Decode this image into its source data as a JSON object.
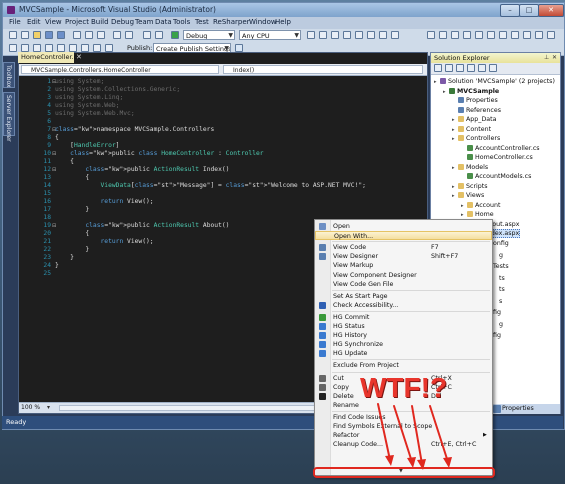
{
  "window": {
    "title": "MVCSample - Microsoft Visual Studio (Administrator)",
    "controls": {
      "minimize": "–",
      "maximize": "□",
      "close": "✕"
    }
  },
  "menu": [
    "File",
    "Edit",
    "View",
    "Project",
    "Build",
    "Debug",
    "Team",
    "Data",
    "Tools",
    "Test",
    "ReSharper",
    "Window",
    "Help"
  ],
  "toolbar": {
    "config": "Debug",
    "platform": "Any CPU",
    "publish_label": "Publish:",
    "publish_value": "Create Publish Settings"
  },
  "editor": {
    "tab": "HomeController.cs",
    "nav_left": "MVCSample.Controllers.HomeController",
    "nav_right": "Index()",
    "zoom": "100 %",
    "line_numbers": [
      "1",
      "2",
      "3",
      "4",
      "5",
      "6",
      "7",
      "8",
      "9",
      "10",
      "11",
      "12",
      "13",
      "14",
      "15",
      "16",
      "17",
      "18",
      "19",
      "20",
      "21",
      "22",
      "23",
      "24",
      "25"
    ],
    "code": [
      "using System;",
      "using System.Collections.Generic;",
      "using System.Linq;",
      "using System.Web;",
      "using System.Web.Mvc;",
      "",
      "namespace MVCSample.Controllers",
      "{",
      "    [HandleError]",
      "    public class HomeController : Controller",
      "    {",
      "        public ActionResult Index()",
      "        {",
      "            ViewData[\"Message\"] = \"Welcome to ASP.NET MVC!\";",
      "",
      "            return View();",
      "        }",
      "",
      "        public ActionResult About()",
      "        {",
      "            return View();",
      "        }",
      "    }",
      "}",
      ""
    ]
  },
  "side_tabs": [
    "Toolbox",
    "Server Explorer"
  ],
  "solution_explorer": {
    "title": "Solution Explorer",
    "nodes": [
      {
        "label": "Solution 'MVCSample' (2 projects)",
        "depth": 0,
        "icon": "solution-icon",
        "color": "#7d5aa8"
      },
      {
        "label": "MVCSample",
        "depth": 1,
        "icon": "project-icon",
        "color": "#3b7a3b"
      },
      {
        "label": "Properties",
        "depth": 2,
        "icon": "properties-icon",
        "color": "#5a7fb0"
      },
      {
        "label": "References",
        "depth": 2,
        "icon": "references-icon",
        "color": "#5a7fb0"
      },
      {
        "label": "App_Data",
        "depth": 2,
        "icon": "folder-icon",
        "color": "#e3c065"
      },
      {
        "label": "Content",
        "depth": 2,
        "icon": "folder-icon",
        "color": "#e3c065"
      },
      {
        "label": "Controllers",
        "depth": 2,
        "icon": "folder-icon",
        "color": "#e3c065"
      },
      {
        "label": "AccountController.cs",
        "depth": 3,
        "icon": "cs-file-icon",
        "color": "#4a8f4a"
      },
      {
        "label": "HomeController.cs",
        "depth": 3,
        "icon": "cs-file-icon",
        "color": "#4a8f4a"
      },
      {
        "label": "Models",
        "depth": 2,
        "icon": "folder-icon",
        "color": "#e3c065"
      },
      {
        "label": "AccountModels.cs",
        "depth": 3,
        "icon": "cs-file-icon",
        "color": "#4a8f4a"
      },
      {
        "label": "Scripts",
        "depth": 2,
        "icon": "folder-icon",
        "color": "#e3c065"
      },
      {
        "label": "Views",
        "depth": 2,
        "icon": "folder-icon",
        "color": "#e3c065"
      },
      {
        "label": "Account",
        "depth": 3,
        "icon": "folder-icon",
        "color": "#e3c065"
      },
      {
        "label": "Home",
        "depth": 3,
        "icon": "folder-icon",
        "color": "#e3c065"
      },
      {
        "label": "About.aspx",
        "depth": 4,
        "icon": "aspx-file-icon",
        "color": "#8aa7cf"
      },
      {
        "label": "Index.aspx",
        "depth": 4,
        "icon": "aspx-file-icon",
        "color": "#8aa7cf",
        "selected": true
      }
    ],
    "partial_right": [
      "onfig",
      "g",
      "Tests",
      "ts",
      "ts",
      "s",
      "fig",
      "g",
      "fig"
    ]
  },
  "properties_tab": "Properties",
  "status": "Ready",
  "context_menu": {
    "items": [
      {
        "label": "Open",
        "shortcut": "",
        "icon": "open-icon",
        "color": "#6d8fc4"
      },
      {
        "label": "Open With...",
        "shortcut": "",
        "icon": "",
        "color": "",
        "highlight": true
      },
      {
        "sep": true
      },
      {
        "label": "View Code",
        "shortcut": "F7",
        "icon": "view-code-icon",
        "color": "#5a7fb0"
      },
      {
        "label": "View Designer",
        "shortcut": "Shift+F7",
        "icon": "view-designer-icon",
        "color": "#5a7fb0"
      },
      {
        "label": "View Markup",
        "shortcut": "",
        "icon": "",
        "color": ""
      },
      {
        "label": "View Component Designer",
        "shortcut": "",
        "icon": "",
        "color": ""
      },
      {
        "label": "View Code Gen File",
        "shortcut": "",
        "icon": "",
        "color": ""
      },
      {
        "sep": true
      },
      {
        "label": "Set As Start Page",
        "shortcut": "",
        "icon": "",
        "color": ""
      },
      {
        "label": "Check Accessibility...",
        "shortcut": "",
        "icon": "accessibility-icon",
        "color": "#2f5fb3"
      },
      {
        "sep": true
      },
      {
        "label": "HG Commit",
        "shortcut": "",
        "icon": "hg-commit-icon",
        "color": "#3a9a3a"
      },
      {
        "label": "HG Status",
        "shortcut": "",
        "icon": "hg-status-icon",
        "color": "#3a7ad0"
      },
      {
        "label": "HG History",
        "shortcut": "",
        "icon": "hg-history-icon",
        "color": "#3a7ad0"
      },
      {
        "label": "HG Synchronize",
        "shortcut": "",
        "icon": "hg-sync-icon",
        "color": "#3a7ad0"
      },
      {
        "label": "HG Update",
        "shortcut": "",
        "icon": "hg-update-icon",
        "color": "#3a7ad0"
      },
      {
        "sep": true
      },
      {
        "label": "Exclude From Project",
        "shortcut": "",
        "icon": "",
        "color": ""
      },
      {
        "sep": true
      },
      {
        "label": "Cut",
        "shortcut": "Ctrl+X",
        "icon": "cut-icon",
        "color": "#666666"
      },
      {
        "label": "Copy",
        "shortcut": "Ctrl+C",
        "icon": "copy-icon",
        "color": "#666666"
      },
      {
        "label": "Delete",
        "shortcut": "Del",
        "icon": "delete-icon",
        "color": "#222222"
      },
      {
        "label": "Rename",
        "shortcut": "",
        "icon": "",
        "color": ""
      },
      {
        "sep": true
      },
      {
        "label": "Find Code Issues",
        "shortcut": "",
        "icon": "",
        "color": ""
      },
      {
        "label": "Find Symbols External to Scope",
        "shortcut": "",
        "icon": "",
        "color": ""
      },
      {
        "label": "Refactor",
        "shortcut": "",
        "icon": "",
        "color": "",
        "submenu": true
      },
      {
        "label": "Cleanup Code...",
        "shortcut": "Ctrl+E, Ctrl+C",
        "icon": "",
        "color": ""
      }
    ],
    "more_arrow": "▼"
  },
  "annotation": {
    "text": "WTF!?",
    "color": "#e8352c"
  }
}
